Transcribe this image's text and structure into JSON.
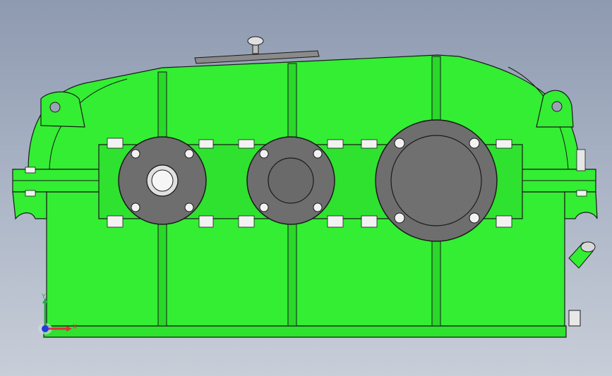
{
  "viewport": {
    "background_top": "#8e9ab0",
    "background_bottom": "#c8ced8"
  },
  "model": {
    "part": "gear-reducer-housing",
    "body_color": "#33ee33",
    "body_shadow_color": "#22bb22",
    "edge_color": "#1a1a1a",
    "cover_color": "#6e6e6e",
    "bolt_color": "#f2f2f2"
  },
  "triad": {
    "x_label": "X",
    "y_label": "Y",
    "x_color": "#e0303a",
    "y_color": "#2aa84a",
    "z_color": "#1f3fd8"
  }
}
